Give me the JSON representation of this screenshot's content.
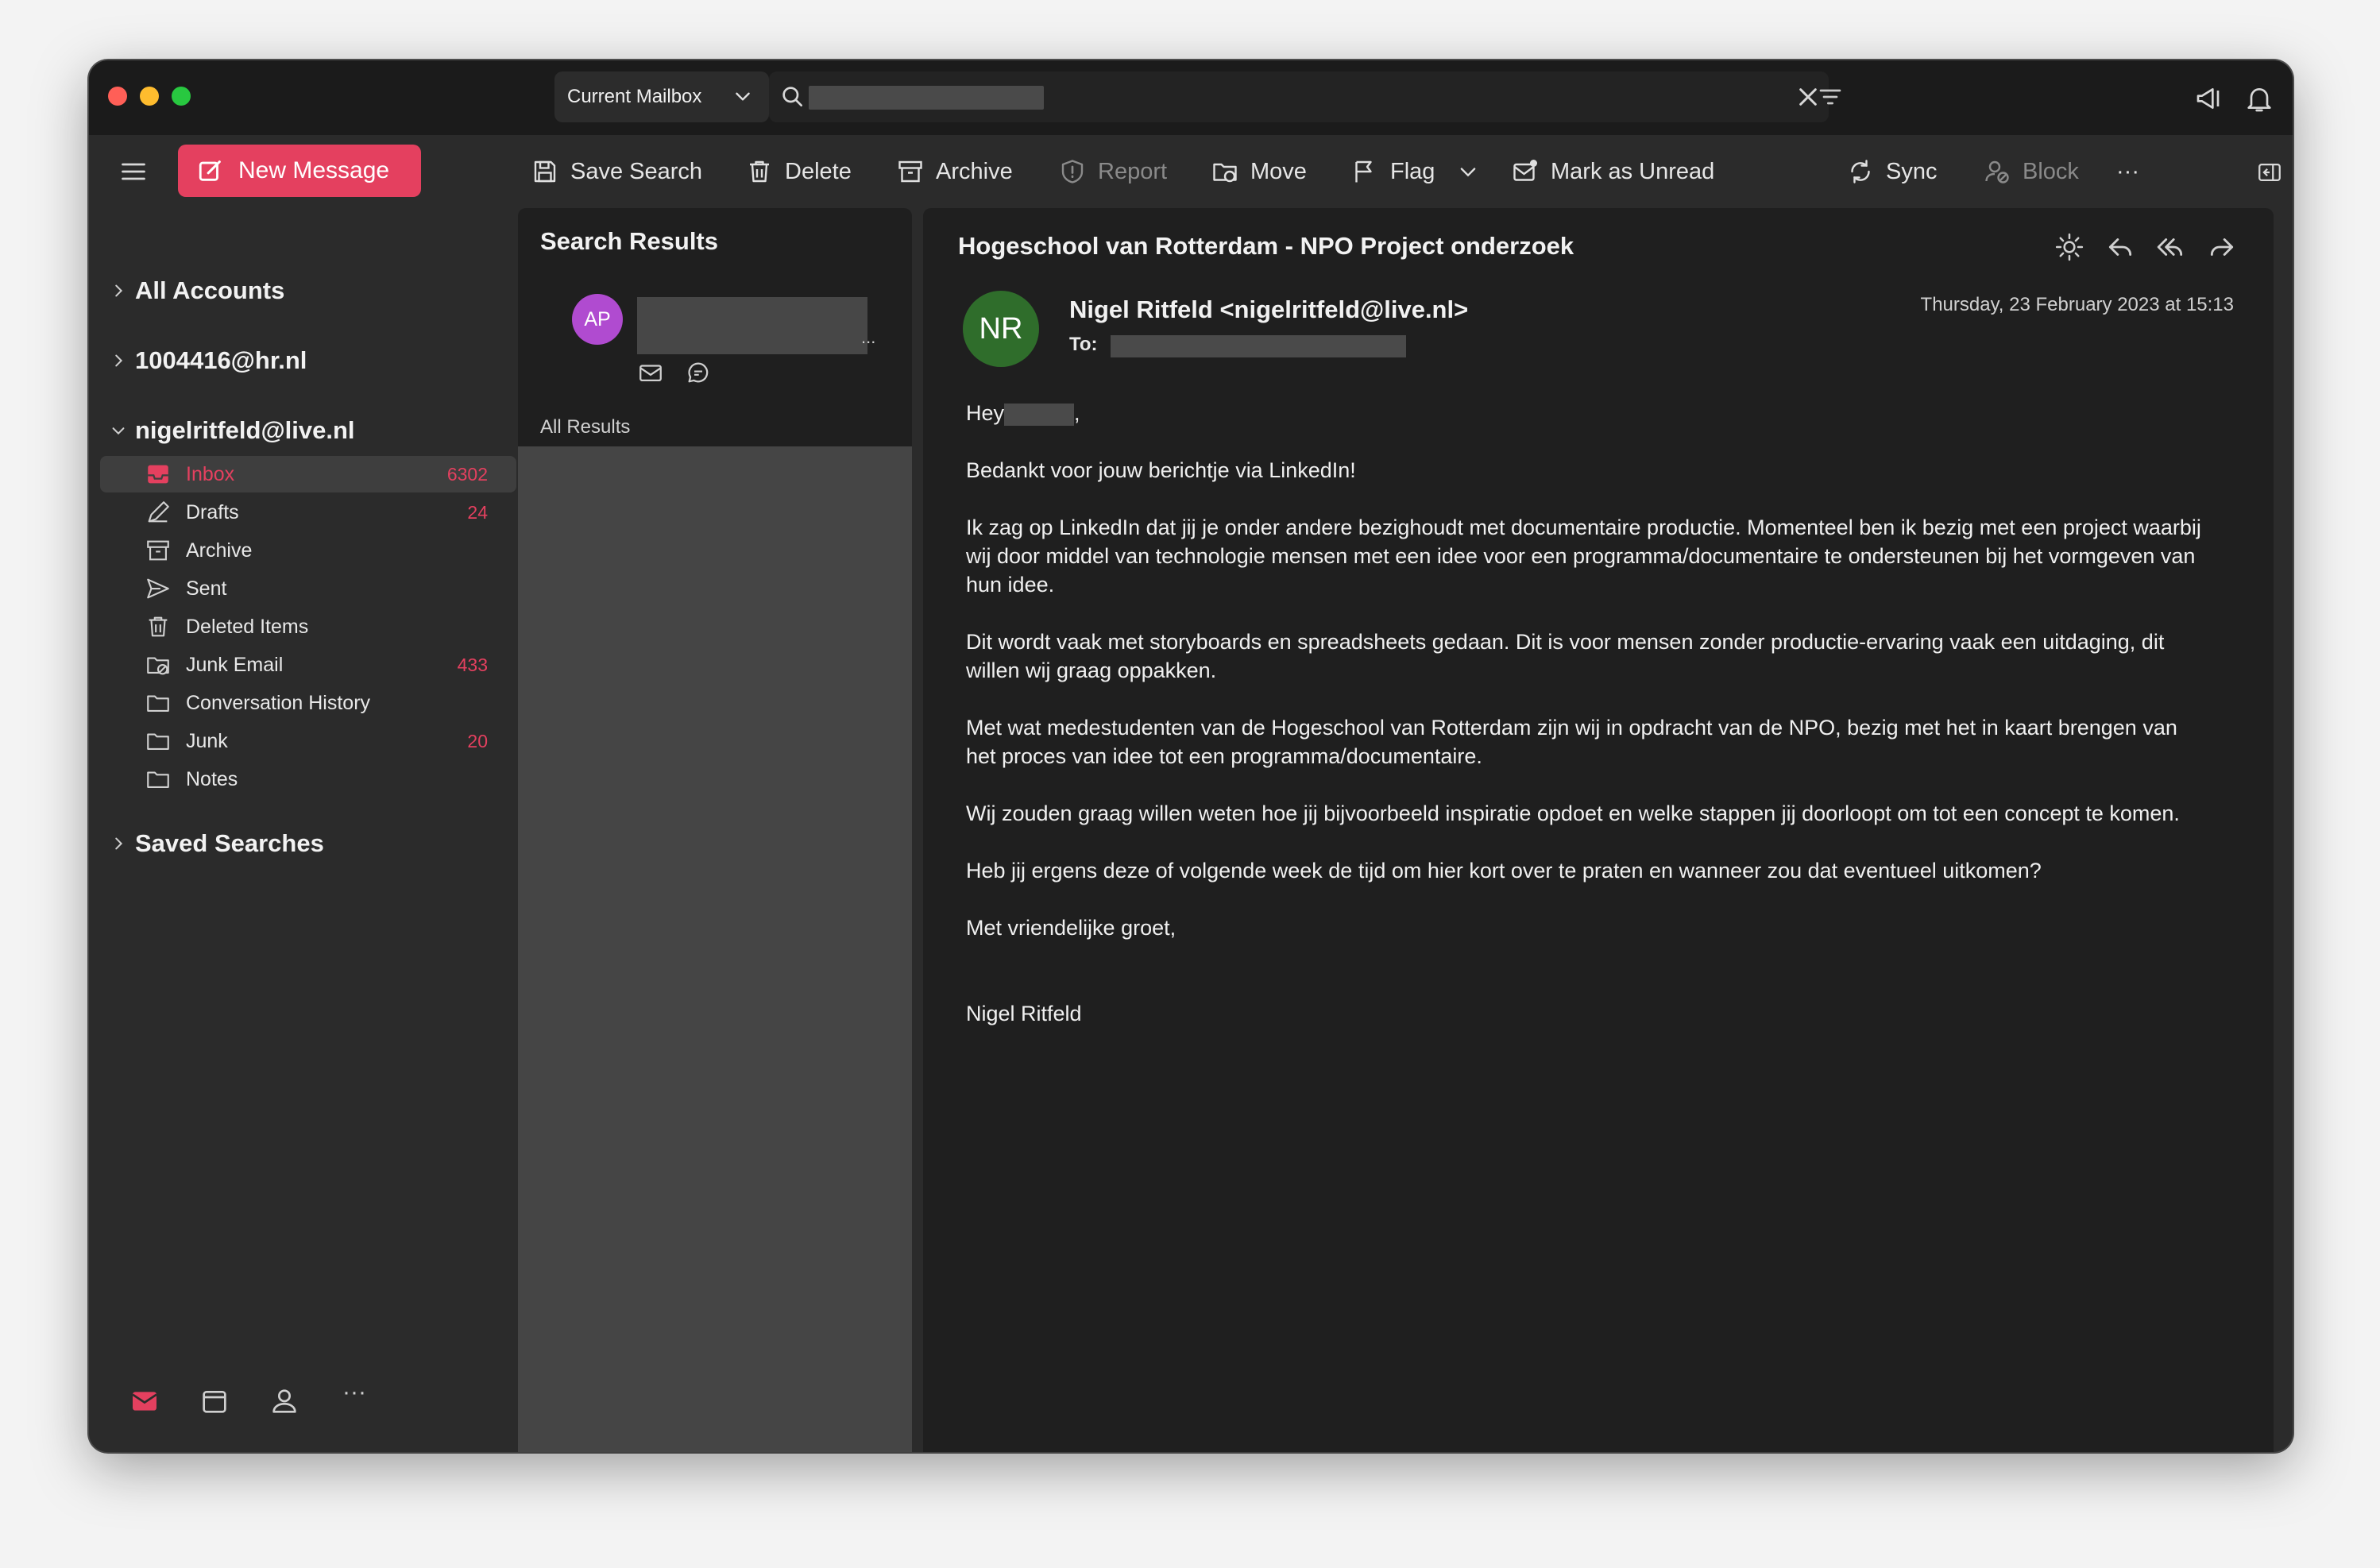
{
  "titlebar": {
    "mailbox_scope": "Current Mailbox"
  },
  "toolbar": {
    "new_message": "New Message",
    "save_search": "Save Search",
    "delete": "Delete",
    "archive": "Archive",
    "report": "Report",
    "move": "Move",
    "flag": "Flag",
    "mark_unread": "Mark as Unread",
    "sync": "Sync",
    "block": "Block",
    "more": "···"
  },
  "sidebar": {
    "all_accounts": "All Accounts",
    "account1": "1004416@hr.nl",
    "account2": "nigelritfeld@live.nl",
    "folders": [
      {
        "label": "Inbox",
        "count": "6302"
      },
      {
        "label": "Drafts",
        "count": "24"
      },
      {
        "label": "Archive",
        "count": ""
      },
      {
        "label": "Sent",
        "count": ""
      },
      {
        "label": "Deleted Items",
        "count": ""
      },
      {
        "label": "Junk Email",
        "count": "433"
      },
      {
        "label": "Conversation History",
        "count": ""
      },
      {
        "label": "Junk",
        "count": "20"
      },
      {
        "label": "Notes",
        "count": ""
      }
    ],
    "saved_searches": "Saved Searches",
    "bottom_more": "···"
  },
  "message_list": {
    "title": "Search Results",
    "avatar_initials": "AP",
    "truncation": "...",
    "all_results": "All Results"
  },
  "reading": {
    "subject": "Hogeschool van Rotterdam - NPO Project onderzoek",
    "avatar_initials": "NR",
    "sender": "Nigel Ritfeld <nigelritfeld@live.nl>",
    "to_label": "To:",
    "date": "Thursday, 23 February 2023 at 15:13",
    "greeting_prefix": "Hey",
    "greeting_suffix": ",",
    "paragraphs": [
      "Bedankt voor jouw berichtje via LinkedIn!",
      "Ik zag op LinkedIn dat jij je onder andere bezighoudt met documentaire productie. Momenteel ben ik bezig met een project waarbij wij door middel van technologie mensen met een idee voor een programma/documentaire te ondersteunen bij het vormgeven van hun idee.",
      "Dit wordt vaak met storyboards en spreadsheets gedaan. Dit is voor mensen zonder productie-ervaring vaak een uitdaging, dit willen wij graag oppakken.",
      "Met wat medestudenten van de Hogeschool van Rotterdam zijn wij in opdracht van de NPO, bezig met het in kaart brengen van het proces van idee tot een programma/documentaire.",
      "Wij zouden graag willen weten hoe jij bijvoorbeeld inspiratie opdoet en welke stappen jij doorloopt om tot een concept te komen.",
      "Heb jij ergens deze of volgende week de tijd om hier kort over te praten en wanneer zou dat eventueel uitkomen?",
      "Met vriendelijke groet,"
    ],
    "signature": "Nigel Ritfeld"
  },
  "colors": {
    "accent": "#e4405f",
    "avatar_ap": "#b04bd0",
    "avatar_nr": "#2f6d2b"
  }
}
